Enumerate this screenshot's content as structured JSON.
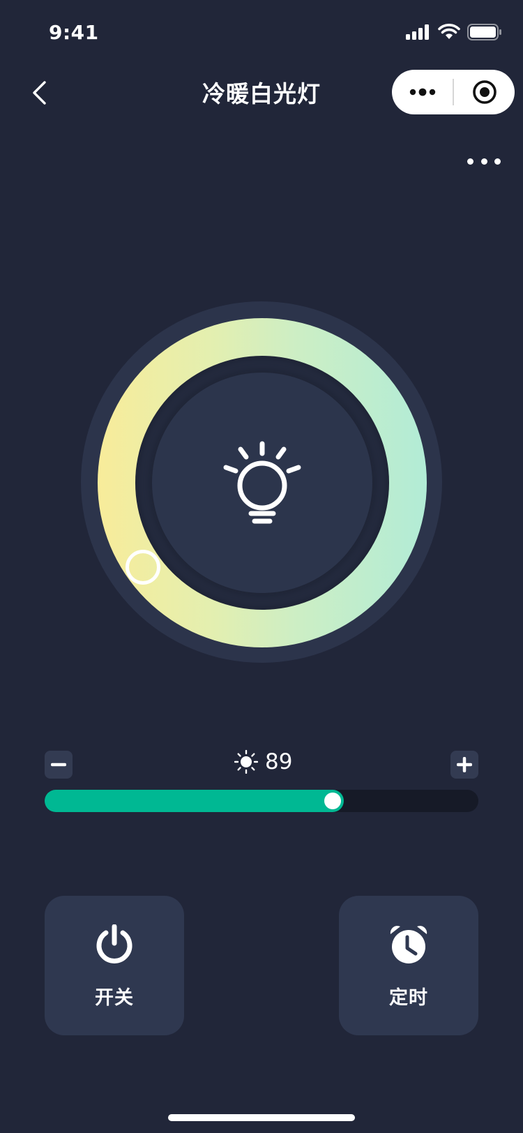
{
  "status_bar": {
    "time": "9:41"
  },
  "nav": {
    "title": "冷暖白光灯"
  },
  "brightness": {
    "value": "89",
    "level_fraction": 0.69
  },
  "actions": [
    {
      "label": "开关",
      "icon": "power-icon"
    },
    {
      "label": "定时",
      "icon": "alarm-clock-icon"
    }
  ],
  "colors": {
    "background": "#212639",
    "warm": "#f8ec9a",
    "cool": "#b2ecd6",
    "accent": "#00b893"
  }
}
